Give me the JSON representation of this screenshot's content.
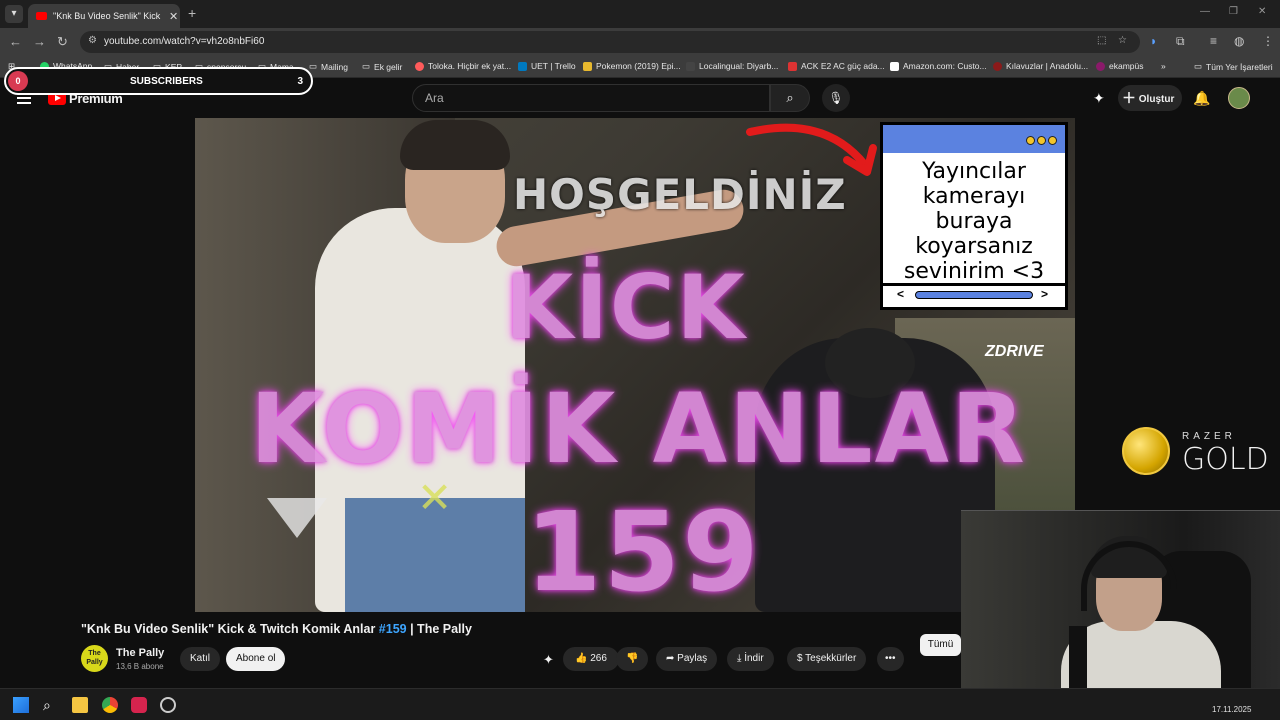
{
  "browser": {
    "tab_title": "\"Knk Bu Video Senlik\" Kick & Tw",
    "url": "youtube.com/watch?v=vh2o8nbFi60",
    "bookmarks": [
      {
        "label": "WhatsApp"
      },
      {
        "label": "Haber"
      },
      {
        "label": "KEP"
      },
      {
        "label": "sponsorcu"
      },
      {
        "label": "Mama"
      },
      {
        "label": "Mailing"
      },
      {
        "label": "Ek gelir"
      },
      {
        "label": "Toloka. Hiçbir ek yat..."
      },
      {
        "label": "UET | Trello"
      },
      {
        "label": "Pokemon (2019) Epi..."
      },
      {
        "label": "Localingual: Diyarb..."
      },
      {
        "label": "ACK E2 AC güç ada..."
      },
      {
        "label": "Amazon.com: Custo..."
      },
      {
        "label": "Kılavuzlar | Anadolu..."
      },
      {
        "label": "ekampüs"
      }
    ],
    "bookmarks_more": "»",
    "all_bookmarks": "Tüm Yer İşaretleri"
  },
  "overlay": {
    "subscribers_label": "SUBSCRIBERS",
    "subscribers_count": "3",
    "subscribers_start": "0"
  },
  "youtube": {
    "logo_text": "Premium",
    "search_placeholder": "Ara",
    "create_label": "Oluştur"
  },
  "video": {
    "banner_top": "HOŞGELDİNİZ",
    "title_line1": "KİCK",
    "title_line2": "KOMİK ANLAR",
    "title_line3": "159",
    "callout_text": "Yayıncılar kamerayı buraya koyarsanız sevinirim <3",
    "watermark": "ZDRIVE"
  },
  "ad": {
    "brand_small": "RAZER",
    "brand_big": "GOLD"
  },
  "meta": {
    "title_prefix": "\"Knk Bu Video Senlik\" Kick & Twitch Komik Anlar ",
    "title_hashtag": "#159",
    "title_suffix": " | The Pally",
    "all_button": "Tümü",
    "channel_avatar_text": "The Pally",
    "channel_name": "The Pally",
    "channel_subs": "13,6 B abone",
    "join_label": "Katıl",
    "subscribe_label": "Abone ol",
    "likes": "266",
    "share_label": "Paylaş",
    "download_label": "İndir",
    "thanks_label": "Teşekkürler"
  },
  "taskbar": {
    "date": "17.11.2025"
  },
  "colors": {
    "yt_red": "#ff0000",
    "hashtag": "#3ea6ff",
    "title_pink": "#e08ee0"
  }
}
